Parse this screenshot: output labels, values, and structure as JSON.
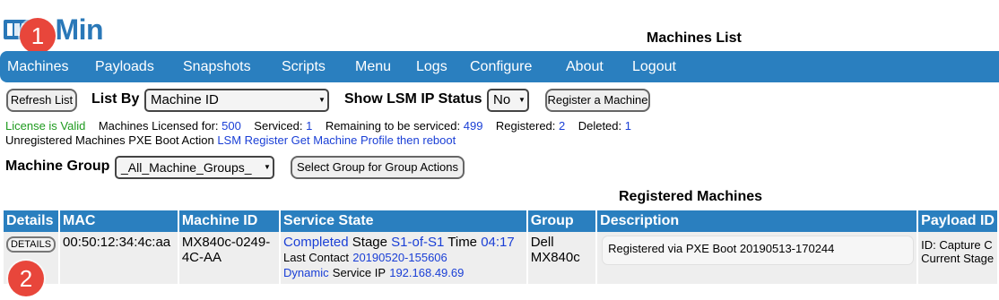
{
  "logo": {
    "text": "inMin"
  },
  "markers": [
    "1",
    "2"
  ],
  "page_title": "Machines List",
  "nav": [
    "Machines",
    "Payloads",
    "Snapshots",
    "Scripts",
    "Menu",
    "Logs",
    "Configure",
    "About",
    "Logout"
  ],
  "toolbar": {
    "refresh_label": "Refresh List",
    "list_by_label": "List By",
    "list_by_value": "Machine ID",
    "lsm_label": "Show LSM IP Status",
    "lsm_value": "No",
    "register_label": "Register a Machine"
  },
  "license": {
    "valid": "License is Valid",
    "licensed_label": "Machines Licensed for:",
    "licensed_value": "500",
    "serviced_label": "Serviced:",
    "serviced_value": "1",
    "remaining_label": "Remaining to be serviced:",
    "remaining_value": "499",
    "registered_label": "Registered:",
    "registered_value": "2",
    "deleted_label": "Deleted:",
    "deleted_value": "1",
    "pxe_label": "Unregistered Machines PXE Boot Action",
    "pxe_value": "LSM Register Get Machine Profile then reboot"
  },
  "group": {
    "label": "Machine Group",
    "value": "_All_Machine_Groups_",
    "action_button": "Select Group for Group Actions"
  },
  "table": {
    "title": "Registered Machines",
    "headers": [
      "Details",
      "MAC",
      "Machine ID",
      "Service State",
      "Group",
      "Description",
      "Payload ID"
    ],
    "row": {
      "details": "DETAILS",
      "mac": "00:50:12:34:4c:aa",
      "machine_id": "MX840c-0249-4C-AA",
      "state": "Completed",
      "stage_label": "Stage",
      "stage": "S1-of-S1",
      "time_label": "Time",
      "time": "04:17",
      "last_contact_label": "Last Contact",
      "last_contact": "20190520-155606",
      "ip_mode": "Dynamic",
      "service_ip_label": "Service IP",
      "service_ip": "192.168.49.69",
      "group": "Dell MX840c",
      "description": "Registered via PXE Boot 20190513-170244",
      "payload_line1": "ID: Capture C",
      "payload_line2": "Current Stage"
    }
  },
  "colors": {
    "nav_bg": "#2a7fbf",
    "brand": "#2a78b8",
    "marker": "#e8463b",
    "link": "#1a3fd6",
    "valid": "#1e9a1e"
  }
}
